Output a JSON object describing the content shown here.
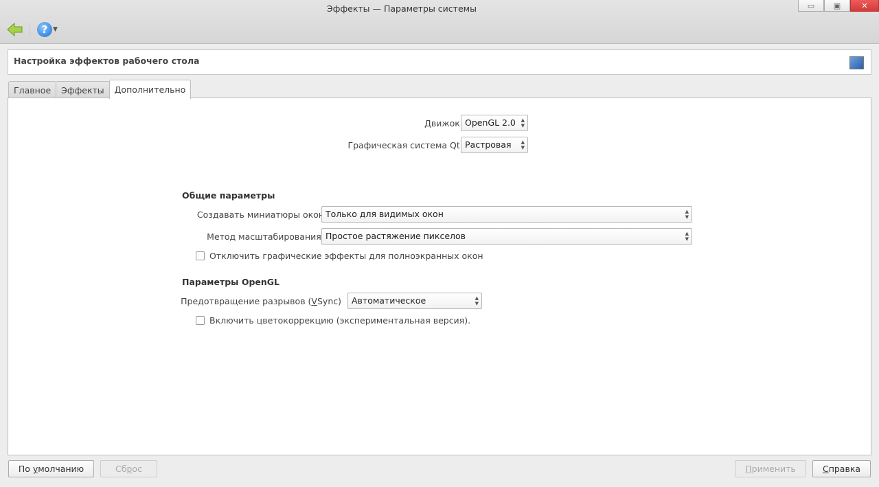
{
  "window": {
    "title": "Эффекты — Параметры системы",
    "minimize": "minimize",
    "maximize": "maximize",
    "close": "close"
  },
  "toolbar": {
    "back": "back-arrow",
    "help": "?"
  },
  "header": {
    "title": "Настройка эффектов рабочего стола"
  },
  "tabs": [
    {
      "label": "Главное"
    },
    {
      "label": "Эффекты"
    },
    {
      "label": "Дополнительно",
      "active": true
    }
  ],
  "advanced": {
    "engine_label": "Движок:",
    "engine_value": "OpenGL 2.0",
    "qt_label": "Графическая система Qt:",
    "qt_value": "Растровая",
    "general_title": "Общие параметры",
    "thumbs_label": "Создавать миниатюры окон",
    "thumbs_value": "Только для видимых окон",
    "scale_label": "Метод масштабирования:",
    "scale_value": "Простое растяжение пикселов",
    "disable_fullscreen_label": "Отключить графические эффекты для полноэкранных окон",
    "disable_fullscreen_checked": false,
    "opengl_title": "Параметры OpenGL",
    "vsync_label_pre": "Предотвращение разрывов (",
    "vsync_label_u": "V",
    "vsync_label_post": "Sync)",
    "vsync_value": "Автоматическое",
    "color_label": "Включить цветокоррекцию (экспериментальная версия).",
    "color_checked": false
  },
  "buttons": {
    "defaults_pre": "По ",
    "defaults_u": "у",
    "defaults_post": "молчанию",
    "reset_pre": "Сб",
    "reset_u": "р",
    "reset_post": "ос",
    "apply_u": "П",
    "apply_post": "рименить",
    "help_u": "С",
    "help_post": "правка"
  }
}
